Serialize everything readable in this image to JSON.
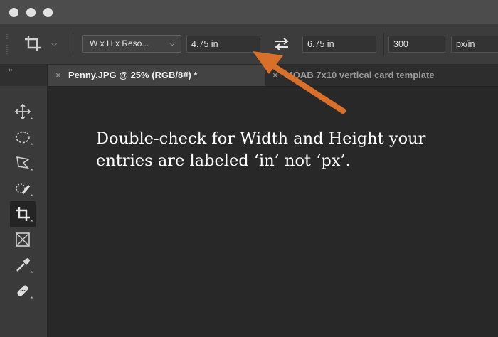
{
  "window": {
    "traffic_lights": [
      "close",
      "minimize",
      "zoom"
    ]
  },
  "options_bar": {
    "tool_icon": "crop-icon",
    "ratio_preset": "W x H x Reso...",
    "width_value": "4.75 in",
    "height_value": "6.75 in",
    "resolution_value": "300",
    "resolution_unit": "px/in",
    "swap_icon": "swap-arrows-icon"
  },
  "tabs": [
    {
      "label": "Penny.JPG @ 25% (RGB/8#) *",
      "active": true,
      "close": "×"
    },
    {
      "label": "MOAB 7x10 vertical card template",
      "active": false,
      "close": "×"
    }
  ],
  "tool_panel": {
    "collapse_glyph": "››",
    "tools": [
      "move-icon",
      "elliptical-marquee-icon",
      "polygonal-lasso-icon",
      "quick-selection-icon",
      "crop-icon",
      "frame-icon",
      "eyedropper-icon",
      "healing-brush-icon"
    ],
    "selected_tool": "crop-icon"
  },
  "annotation": {
    "line1": "Double-check for Width and Height your",
    "line2": "entries are labeled ‘in’ not ‘px’.",
    "arrow_color": "#d9702a"
  },
  "colors": {
    "accent_arrow": "#d9702a",
    "canvas": "#282828"
  }
}
